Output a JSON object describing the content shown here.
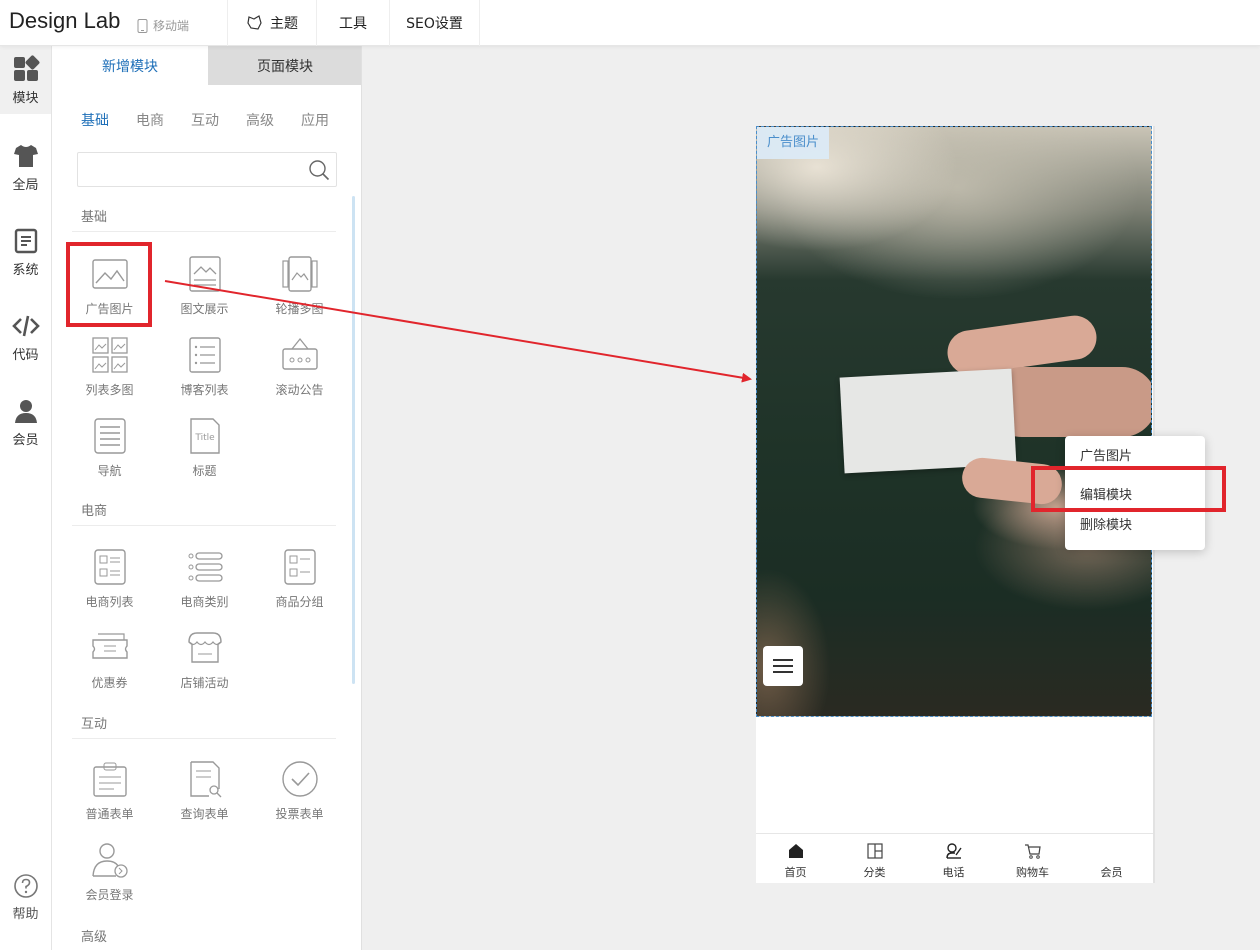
{
  "header": {
    "logo": "Design Lab",
    "device": "移动端",
    "nav": {
      "theme": "主题",
      "tools": "工具",
      "seo": "SEO设置"
    }
  },
  "rail": {
    "items": [
      {
        "label": "模块",
        "icon": "grid-shapes-icon"
      },
      {
        "label": "全局",
        "icon": "tshirt-icon"
      },
      {
        "label": "系统",
        "icon": "document-icon"
      },
      {
        "label": "代码",
        "icon": "code-icon"
      },
      {
        "label": "会员",
        "icon": "user-icon"
      }
    ],
    "help": "帮助"
  },
  "panel": {
    "tabs": {
      "add": "新增模块",
      "page": "页面模块"
    },
    "subtabs": [
      "基础",
      "电商",
      "互动",
      "高级",
      "应用"
    ],
    "search": {
      "placeholder": ""
    },
    "sections": {
      "basic": {
        "title": "基础",
        "items": [
          "广告图片",
          "图文展示",
          "轮播多图",
          "列表多图",
          "博客列表",
          "滚动公告",
          "导航",
          "标题"
        ]
      },
      "ecommerce": {
        "title": "电商",
        "items": [
          "电商列表",
          "电商类别",
          "商品分组",
          "优惠券",
          "店铺活动"
        ]
      },
      "interactive": {
        "title": "互动",
        "items": [
          "普通表单",
          "查询表单",
          "投票表单",
          "会员登录"
        ]
      },
      "advanced": {
        "title": "高级"
      }
    }
  },
  "canvas": {
    "hero_label": "广告图片",
    "tabbar": [
      "首页",
      "分类",
      "电话",
      "购物车",
      "会员"
    ]
  },
  "context_menu": {
    "title": "广告图片",
    "edit": "编辑模块",
    "delete": "删除模块"
  },
  "colors": {
    "accent": "#1e6fb8",
    "annotation": "#e1252c",
    "selection": "#4a8ecb"
  }
}
